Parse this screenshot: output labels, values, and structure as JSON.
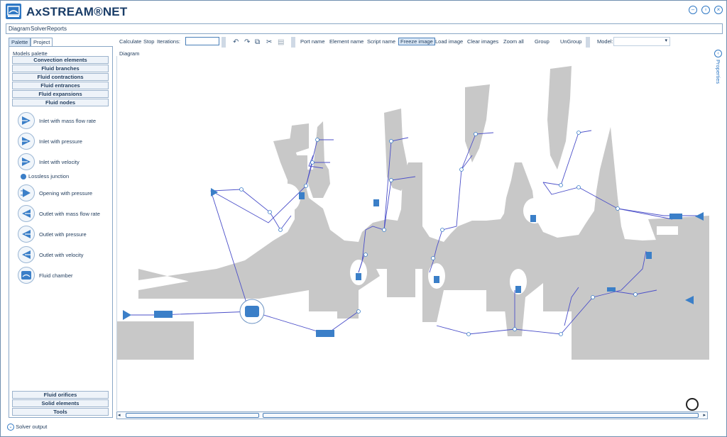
{
  "app": {
    "title": "AxSTREAM®NET"
  },
  "menu": {
    "items": [
      "Diagram",
      "Solver",
      "Reports"
    ]
  },
  "left_tabs": [
    "Palette",
    "Project"
  ],
  "palette": {
    "heading": "Models palette",
    "top_categories": [
      "Convection elements",
      "Fluid branches",
      "Fluid contractions",
      "Fluid entrances",
      "Fluid expansions",
      "Fluid nodes"
    ],
    "items": [
      {
        "label": "Inlet with mass flow rate",
        "icon": "inlet-mass-flow-icon"
      },
      {
        "label": "Inlet with pressure",
        "icon": "inlet-pressure-icon"
      },
      {
        "label": "Inlet with velocity",
        "icon": "inlet-velocity-icon"
      },
      {
        "label": "Lossless junction",
        "icon": "junction-dot-icon"
      },
      {
        "label": "Opening with pressure",
        "icon": "opening-pressure-icon"
      },
      {
        "label": "Outlet with mass flow rate",
        "icon": "outlet-mass-flow-icon"
      },
      {
        "label": "Outlet with pressure",
        "icon": "outlet-pressure-icon"
      },
      {
        "label": "Outlet with velocity",
        "icon": "outlet-velocity-icon"
      },
      {
        "label": "Fluid chamber",
        "icon": "fluid-chamber-icon"
      }
    ],
    "bottom_categories": [
      "Fluid orifices",
      "Solid elements",
      "Tools"
    ]
  },
  "toolbar": {
    "calculate": "Calculate",
    "stop": "Stop",
    "iterations_label": "Iterations:",
    "iterations_value": "",
    "port_name": "Port name",
    "element_name": "Element name",
    "script_name": "Script name",
    "freeze_image": "Freeze image",
    "load_image": "Load image",
    "clear_images": "Clear images",
    "zoom_all": "Zoom all",
    "group": "Group",
    "ungroup": "UnGroup",
    "model_label": "Model:",
    "model_value": ""
  },
  "diagram": {
    "label": "Diagram"
  },
  "properties": {
    "label": "Properties"
  },
  "footer": {
    "solver_output": "Solver output"
  },
  "colors": {
    "accent": "#2f78c4",
    "solid_gray": "#c8c8c8",
    "link": "#4b4fc9",
    "element": "#3b7fc8"
  }
}
